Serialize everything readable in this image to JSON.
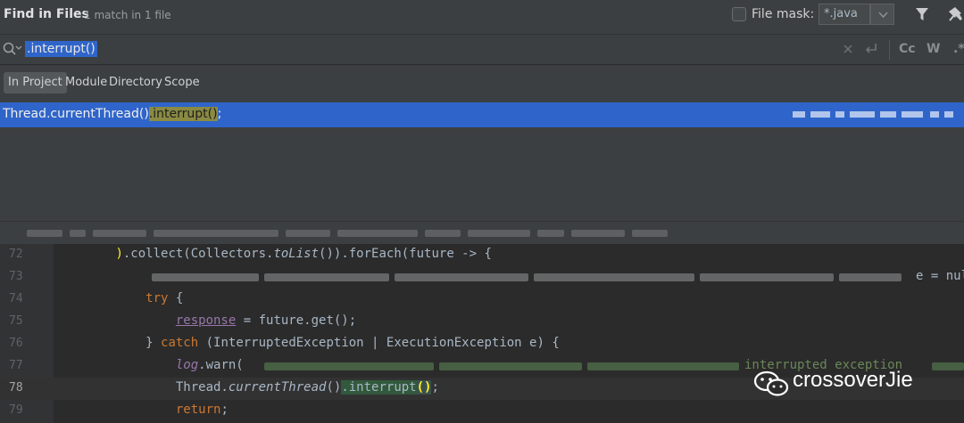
{
  "header": {
    "title": "Find in Files",
    "match_summary": "1 match in 1 file",
    "file_mask_label": "File mask:",
    "file_mask_value": "*.java"
  },
  "search": {
    "query": ".interrupt()",
    "case_label": "Cc",
    "word_label": "W"
  },
  "scope_tabs": [
    {
      "label": "In Project",
      "active": true
    },
    {
      "label": "Module",
      "active": false
    },
    {
      "label": "Directory",
      "active": false
    },
    {
      "label": "Scope",
      "active": false
    }
  ],
  "result": {
    "prefix": "Thread.currentThread()",
    "match": ".interrupt()",
    "suffix": ";"
  },
  "editor": {
    "lines": [
      {
        "num": "72"
      },
      {
        "num": "73"
      },
      {
        "num": "74"
      },
      {
        "num": "75"
      },
      {
        "num": "76"
      },
      {
        "num": "77"
      },
      {
        "num": "78"
      },
      {
        "num": "79"
      }
    ],
    "tail_73": "e = null",
    "str_77": "interrupted exception"
  },
  "watermark": {
    "text": "crossoverJie"
  }
}
